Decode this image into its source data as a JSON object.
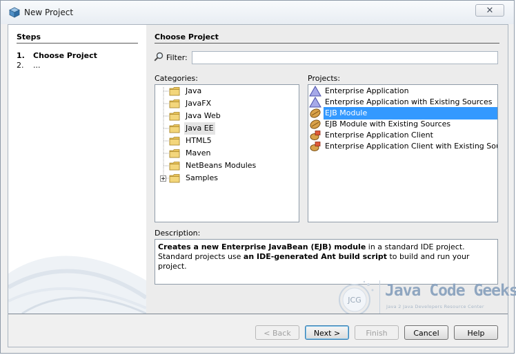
{
  "window": {
    "title": "New Project",
    "close_glyph": "✕"
  },
  "steps": {
    "heading": "Steps",
    "items": [
      {
        "num": "1.",
        "label": "Choose Project"
      },
      {
        "num": "2.",
        "label": "..."
      }
    ]
  },
  "content": {
    "title": "Choose Project",
    "filter": {
      "label": "Filter:",
      "value": ""
    },
    "categories_label": "Categories:",
    "projects_label": "Projects:",
    "description_label": "Description:"
  },
  "categories": [
    {
      "label": "Java",
      "expandable": false
    },
    {
      "label": "JavaFX",
      "expandable": false
    },
    {
      "label": "Java Web",
      "expandable": false
    },
    {
      "label": "Java EE",
      "expandable": false,
      "selected": true
    },
    {
      "label": "HTML5",
      "expandable": false
    },
    {
      "label": "Maven",
      "expandable": false
    },
    {
      "label": "NetBeans Modules",
      "expandable": false
    },
    {
      "label": "Samples",
      "expandable": true
    }
  ],
  "projects": [
    {
      "label": "Enterprise Application",
      "icon": "enterprise-app-icon"
    },
    {
      "label": "Enterprise Application with Existing Sources",
      "icon": "enterprise-app-icon"
    },
    {
      "label": "EJB Module",
      "icon": "ejb-module-icon",
      "selected": true
    },
    {
      "label": "EJB Module with Existing Sources",
      "icon": "ejb-module-icon"
    },
    {
      "label": "Enterprise Application Client",
      "icon": "app-client-icon"
    },
    {
      "label": "Enterprise Application Client with Existing Sources",
      "icon": "app-client-icon"
    }
  ],
  "description": {
    "p1_bold": "Creates a new Enterprise JavaBean (EJB) module",
    "p1": " in a standard IDE project. Standard projects use ",
    "p2_bold": "an IDE-generated Ant build script",
    "p2": " to build and run your project."
  },
  "watermark": {
    "logo_initials": "JCG",
    "brand": "Java Code Geeks",
    "tagline": "Java 2 Java Developers Resource Center"
  },
  "buttons": {
    "back": "< Back",
    "next": "Next >",
    "finish": "Finish",
    "cancel": "Cancel",
    "help": "Help"
  },
  "colors": {
    "selection": "#3399ff",
    "folder": "#e8c35a",
    "brand_text": "#8fa6c0"
  }
}
